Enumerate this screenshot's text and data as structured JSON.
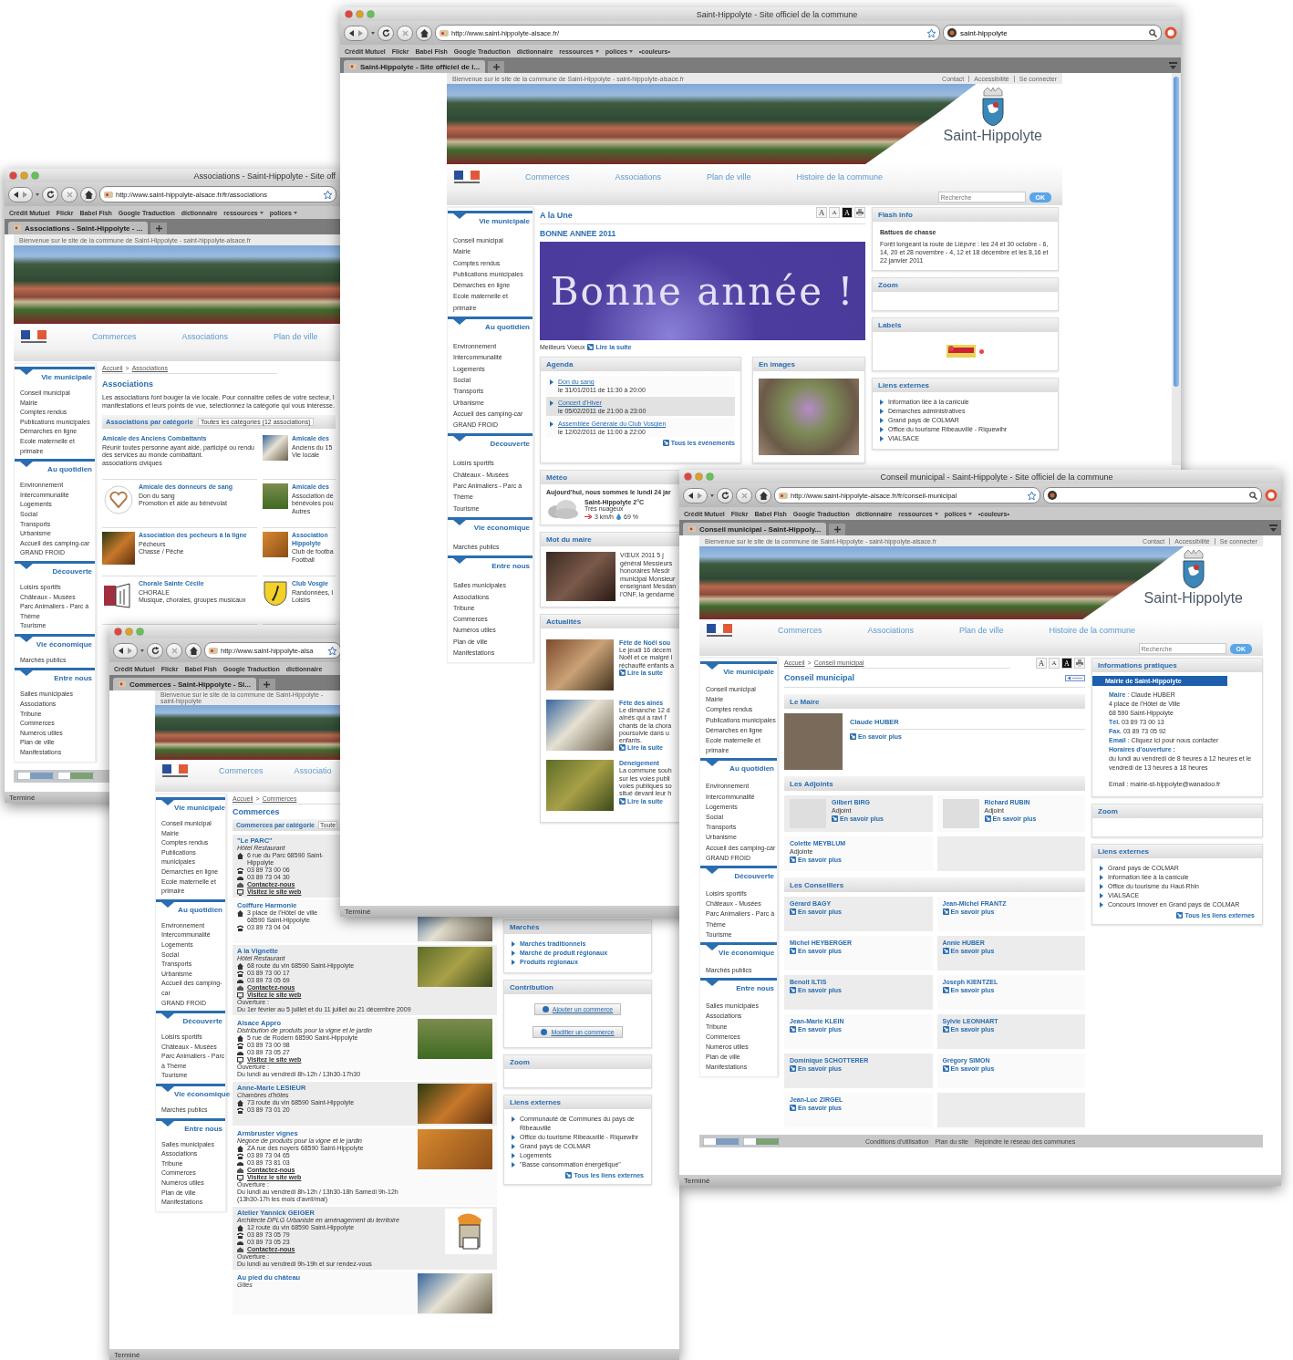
{
  "windows": [
    {
      "kind": "associations",
      "title": "Associations - Saint-Hippolyte - Site off",
      "url": "http://www.saint-hippolyte-alsace.fr/fr/associations",
      "search": false,
      "bookmarks": [
        {
          "label": "Crédit Mutuel",
          "menu": false
        },
        {
          "label": "Flickr",
          "menu": false
        },
        {
          "label": "Babel Fish",
          "menu": false
        },
        {
          "label": "Google Traduction",
          "menu": false
        },
        {
          "label": "dictionnaire",
          "menu": false
        },
        {
          "label": "ressources",
          "menu": true
        },
        {
          "label": "polices",
          "menu": true
        }
      ],
      "tab": "Associations - Saint-Hippolyte - ...",
      "status": "Terminé",
      "page": {
        "welcome": "Bienvenue sur le site de la commune de Saint-Hippolyte - saint-hippolyte-alsace.fr",
        "nav": [
          "Commerces",
          "Associations",
          "Plan de ville"
        ],
        "sidebar": [
          {
            "title": "Vie municipale",
            "items": [
              "Conseil municipal",
              "Mairie",
              "Comptes rendus",
              "Publications municipales",
              "Démarches en ligne",
              "Ecole maternelle et primaire"
            ]
          },
          {
            "title": "Au quotidien",
            "items": [
              "Environnement",
              "Intercommunalité",
              "Logements",
              "Social",
              "Transports",
              "Urbanisme",
              "Accueil des camping-car",
              "GRAND FROID"
            ]
          },
          {
            "title": "Découverte",
            "items": [
              "Loisirs sportifs",
              "Châteaux - Musées",
              "Parc Animaliers - Parc à Thème",
              "Tourisme"
            ]
          },
          {
            "title": "Vie économique",
            "items": [
              "Marchés publics"
            ]
          },
          {
            "title": "Entre nous",
            "items": [
              "Salles municipales",
              "Associations",
              "Tribune",
              "Commerces",
              "Numéros utiles",
              "Plan de ville",
              "Manifestations"
            ]
          }
        ],
        "content": {
          "kind": "associations",
          "breadcrumb": [
            "Accueil",
            "Associations"
          ],
          "separator": ">",
          "heading": "Associations",
          "intro": [
            "Les associations font bouger la vie locale. Pour connaître celles de votre secteur, l",
            "manifestations et leurs points de vue, sélectionnez la catégorie qui vous intéresse."
          ],
          "category": {
            "label": "Associations par catégorie",
            "select": "Toutes les catégories (12 associations)"
          },
          "entries": [
            {
              "name": "Amicale des Anciens Combattants",
              "lines": [
                "Réunir toutes personne ayant aidé, participé ou rendu des services au monde combattant.",
                "associations civiques"
              ],
              "kind": "text"
            },
            {
              "name": "Amicale des",
              "lines": [
                "Anciens du 15",
                "Vie locale"
              ],
              "kind": "photo"
            },
            {
              "name": "Amicale des donneurs de sang",
              "lines": [
                "Don du sang",
                "Promotion et aide au bénévolat"
              ],
              "kind": "logo"
            },
            {
              "name": "Amicale des",
              "lines": [
                "Association de",
                "bénévoles pou",
                "Autres"
              ],
              "kind": "photo"
            },
            {
              "name": "Association des pecheurs à la ligne",
              "lines": [
                "Pêcheurs",
                "Chasse / Pêche"
              ],
              "kind": "photo"
            },
            {
              "name": "Association Hippolyte",
              "lines": [
                "Club de footba",
                "Football"
              ],
              "kind": "photo"
            },
            {
              "name": "Chorale Sainte Cécile",
              "lines": [
                "CHORALE",
                "Musique, chorales, groupes musicaux"
              ],
              "kind": "drawing"
            },
            {
              "name": "Club Vosgie",
              "lines": [
                "Randonnées, l",
                "Loisirs"
              ],
              "kind": "shield"
            }
          ]
        },
        "footer": true
      }
    },
    {
      "kind": "commerces",
      "url": "http://www.saint-hippolyte-alsa",
      "search": false,
      "bookmarks": [
        {
          "label": "Crédit Mutuel",
          "menu": false
        },
        {
          "label": "Flickr",
          "menu": false
        },
        {
          "label": "Babel Fish",
          "menu": false
        },
        {
          "label": "Google Traduction",
          "menu": false
        },
        {
          "label": "dictionnaire",
          "menu": false
        }
      ],
      "tab": "Commerces - Saint-Hippolyte - Si...",
      "status": "Terminé",
      "page": {
        "welcome": "Bienvenue sur le site de la commune de Saint-Hippolyte - saint-hippolyte",
        "nav": [
          "Commerces",
          "Associatio"
        ],
        "sidebar": [
          {
            "title": "Vie municipale",
            "items": [
              "Conseil municipal",
              "Mairie",
              "Comptes rendus",
              "Publications municipales",
              "Démarches en ligne",
              "Ecole maternelle et primaire"
            ]
          },
          {
            "title": "Au quotidien",
            "items": [
              "Environnement",
              "Intercommunalité",
              "Logements",
              "Social",
              "Transports",
              "Urbanisme",
              "Accueil des camping-car",
              "GRAND FROID"
            ]
          },
          {
            "title": "Découverte",
            "items": [
              "Loisirs sportifs",
              "Châteaux - Musées",
              "Parc Animaliers - Parc à Thème",
              "Tourisme"
            ]
          },
          {
            "title": "Vie économique",
            "items": [
              "Marchés publics"
            ]
          },
          {
            "title": "Entre nous",
            "items": [
              "Salles municipales",
              "Associations",
              "Tribune",
              "Commerces",
              "Numéros utiles",
              "Plan de ville",
              "Manifestations"
            ]
          }
        ],
        "content": {
          "kind": "commerces",
          "breadcrumb": [
            "Accueil",
            "Commerces"
          ],
          "separator": ">",
          "heading": "Commerces",
          "category": {
            "label": "Commerces par catégorie",
            "select": "Toute"
          },
          "entries": [
            {
              "name": "\"Le PARC\"",
              "subtitle": "Hôtel Restaurant",
              "kind": "text",
              "fields": [
                {
                  "kind": "address",
                  "text": "6 rue du Parc 68590 Saint-Hippolyte"
                },
                {
                  "kind": "phone",
                  "text": "03 89 73 00 06"
                },
                {
                  "kind": "fax",
                  "text": "03 89 73 04 30"
                },
                {
                  "kind": "contact",
                  "text": "Contactez-nous"
                },
                {
                  "kind": "web",
                  "text": "Visitez le site web"
                }
              ]
            },
            {
              "name": "Coiffure Harmonie",
              "kind": "photo",
              "fields": [
                {
                  "kind": "address",
                  "text": "3 place de l'Hôtel de ville 68590 Saint-Hippolyte"
                },
                {
                  "kind": "phone",
                  "text": "03 89 73 04 04"
                }
              ]
            },
            {
              "name": "A la Vignette",
              "subtitle": "Hôtel Restaurant",
              "kind": "photo",
              "fields": [
                {
                  "kind": "address",
                  "text": "68 route du vin 68590 Saint-Hippolyte"
                },
                {
                  "kind": "phone",
                  "text": "03 89 73 00 17"
                },
                {
                  "kind": "fax",
                  "text": "03 89 73 05 69"
                },
                {
                  "kind": "contact",
                  "text": "Contactez-nous"
                },
                {
                  "kind": "web",
                  "text": "Visitez le site web"
                },
                {
                  "kind": "hours_label",
                  "text": "Ouverture :"
                },
                {
                  "kind": "hours",
                  "text": "Du 1er février au 5 juillet et du 11 juillet au 21 décembre 2009"
                }
              ]
            },
            {
              "name": "Alsace Appro",
              "subtitle": "Distribution de produits pour la vigne et le jardin",
              "kind": "photo",
              "fields": [
                {
                  "kind": "address",
                  "text": "5 rue de Rodern 68590 Saint-Hippolyte"
                },
                {
                  "kind": "phone",
                  "text": "03 89 73 00 98"
                },
                {
                  "kind": "fax",
                  "text": "03 89 73 05 27"
                },
                {
                  "kind": "web",
                  "text": "Visitez le site web"
                },
                {
                  "kind": "hours_label",
                  "text": "Ouverture :"
                },
                {
                  "kind": "hours",
                  "text": "Du lundi au vendredi 8h-12h / 13h30-17h30"
                }
              ]
            },
            {
              "name": "Anne-Marie LESIEUR",
              "subtitle": "Chambres d'hôtes",
              "kind": "photo",
              "fields": [
                {
                  "kind": "address",
                  "text": "73 route du vin 68590 Saint-Hippolyte"
                },
                {
                  "kind": "phone",
                  "text": "03 89 73 01 20"
                }
              ]
            },
            {
              "name": "Armbruster vignes",
              "subtitle": "Négoce de produits pour la vigne et le jardin",
              "kind": "photo",
              "fields": [
                {
                  "kind": "address",
                  "text": "ZA rue des noyers 68590 Saint-Hippolyte"
                },
                {
                  "kind": "phone",
                  "text": "03 89 73 04 65"
                },
                {
                  "kind": "fax",
                  "text": "03 89 73 81 03"
                },
                {
                  "kind": "contact",
                  "text": "Contactez-nous"
                },
                {
                  "kind": "web",
                  "text": "Visitez le site web"
                },
                {
                  "kind": "hours_label",
                  "text": "Ouverture :"
                },
                {
                  "kind": "hours",
                  "text": "Du lundi au vendredi 8h-12h / 13h30-18h Samedi 9h-12h (13h30-17h les mois d'avril/mai)"
                }
              ]
            },
            {
              "name": "Atelier Yannick GEIGER",
              "subtitle": "Architecte DPLG Urbaniste en aménagement du territoire",
              "kind": "drawing",
              "fields": [
                {
                  "kind": "address",
                  "text": "12 route du vin 68590 Saint-Hippolyte"
                },
                {
                  "kind": "phone",
                  "text": "03 89 73 05 79"
                },
                {
                  "kind": "fax",
                  "text": "03 89 73 05 23"
                },
                {
                  "kind": "contact",
                  "text": "Contactez-nous"
                },
                {
                  "kind": "hours_label",
                  "text": "Ouverture :"
                },
                {
                  "kind": "hours",
                  "text": "Du lundi au vendredi 9h-19h et sur rendez-vous"
                }
              ]
            },
            {
              "name": "Au pied du château",
              "subtitle": "Gîtes",
              "kind": "photo"
            }
          ]
        },
        "side": [
          {
            "kind": "nav_links",
            "title": "Marchés",
            "items": [
              "Marchés traditionnels",
              "Marché de produit régionaux",
              "Produits régionaux"
            ]
          },
          {
            "kind": "buttons",
            "title": "Contribution",
            "buttons": [
              "Ajouter un commerce",
              "Modifier un commerce"
            ]
          },
          {
            "kind": "empty",
            "title": "Zoom"
          },
          {
            "kind": "links",
            "title": "Liens externes",
            "items": [
              "Communauté de Communes du pays de Ribeauvillé",
              "Office du tourisme Ribeauvillé - Riquewihr",
              "Grand pays de COLMAR",
              "Logements",
              "\"Basse consommation énergétique\""
            ],
            "more": "Tous les liens externes"
          }
        ]
      }
    },
    {
      "kind": "main",
      "title": "Saint-Hippolyte - Site officiel de la commune",
      "url": "http://www.saint-hippolyte-alsace.fr/",
      "search": true,
      "search_value": "saint-hippolyte",
      "bookmarks": [
        {
          "label": "Crédit Mutuel",
          "menu": false
        },
        {
          "label": "Flickr",
          "menu": false
        },
        {
          "label": "Babel Fish",
          "menu": false
        },
        {
          "label": "Google Traduction",
          "menu": false
        },
        {
          "label": "dictionnaire",
          "menu": false
        },
        {
          "label": "ressources",
          "menu": true
        },
        {
          "label": "polices",
          "menu": true
        },
        {
          "label": "•couleurs•",
          "menu": false
        }
      ],
      "tab": "Saint-Hippolyte - Site officiel de l...",
      "status": "Terminé",
      "page": {
        "welcome": "Bienvenue sur le site de la commune de Saint-Hippolyte - saint-hippolyte-alsace.fr",
        "top_links": [
          "Contact",
          "Accessibilité",
          "Se connecter"
        ],
        "site_name": "Saint-Hippolyte",
        "nav": [
          "Commerces",
          "Associations",
          "Plan de ville",
          "Histoire de la commune"
        ],
        "search": {
          "placeholder": "Recherche",
          "button": "OK"
        },
        "sidebar": [
          {
            "title": "Vie municipale",
            "items": [
              "Conseil municipal",
              "Mairie",
              "Comptes rendus",
              "Publications municipales",
              "Démarches en ligne",
              "Ecole maternelle et primaire"
            ]
          },
          {
            "title": "Au quotidien",
            "items": [
              "Environnement",
              "Intercommunalité",
              "Logements",
              "Social",
              "Transports",
              "Urbanisme",
              "Accueil des camping-car",
              "GRAND FROID"
            ]
          },
          {
            "title": "Découverte",
            "items": [
              "Loisirs sportifs",
              "Châteaux - Musées",
              "Parc Animaliers - Parc à Thème",
              "Tourisme"
            ]
          },
          {
            "title": "Vie économique",
            "items": [
              "Marchés publics"
            ]
          },
          {
            "title": "Entre nous",
            "items": [
              "Salles municipales",
              "Associations",
              "Tribune",
              "Commerces",
              "Numéros utiles",
              "Plan de ville",
              "Manifestations"
            ]
          }
        ],
        "content": {
          "kind": "une",
          "heading": "A la Une",
          "tools": [
            {
              "kind": "larger",
              "label": "A"
            },
            {
              "kind": "smaller",
              "label": "A"
            },
            {
              "kind": "contrast",
              "label": "A"
            },
            {
              "kind": "print"
            }
          ],
          "news_title": "BONNE ANNEE 2011",
          "greeting": "Bonne année !",
          "caption": "Meilleurs Voeux",
          "read_more": "Lire la suite",
          "agenda": {
            "title": "Agenda",
            "items": [
              {
                "title": "Don du sang",
                "date": "le 31/01/2011 de 11:30 à 20:00",
                "highlighted": false
              },
              {
                "title": "Concert d'Hiver",
                "date": "le 05/02/2011 de 21:00 à 23:00",
                "highlighted": true
              },
              {
                "title": "Assemblée Générale du Club Vosgien",
                "date": "le 12/02/2011 de 11:00 à 22:00",
                "highlighted": false
              }
            ],
            "more": "Tous les événements"
          },
          "images_title": "En images",
          "weather": {
            "title": "Météo",
            "today": "Aujourd'hui, nous sommes le lundi 24 jar",
            "place": "Saint-Hippolyte 2°C",
            "condition": "Très nuageux",
            "wind": "3 km/h",
            "humidity": "69 %"
          },
          "mayor": {
            "title": "Mot du maire",
            "text": "VŒUX 2011 5 j général Messieurs honoraires Mesdr municipal Monsieur enseignant Mesdan l'ONF, la gendarme"
          },
          "news": {
            "title": "Actualités",
            "items": [
              {
                "title": "Fête de Noël sou",
                "text": "Le jeudi 16 décem Noël et ce malgré l réchauffé enfants a",
                "link": "Lire la suite"
              },
              {
                "title": "Fête des aînés",
                "text": "Le dimanche 12 d aînés qui a ravi l' chants de la chora poursuivie dans u enfants.",
                "link": "Lire la suite"
              },
              {
                "title": "Déneigement",
                "text": "La commune souh sur les voies publi voies publiques so situé devant leur h",
                "link": "Lire la suite"
              }
            ]
          }
        },
        "side": [
          {
            "kind": "text",
            "title": "Flash info",
            "subtitle": "Battues de chasse",
            "text": "Forêt longeant la route de Lièpvre : les 24 et 30 octobre - 6, 14, 20 et 28 novembre - 4, 12 et 18 décembre et les 8,16 et 22 janvier 2011"
          },
          {
            "kind": "empty",
            "title": "Zoom"
          },
          {
            "kind": "labels",
            "title": "Labels"
          },
          {
            "kind": "links",
            "title": "Liens externes",
            "items": [
              "Information liée à la canicule",
              "Démarches administratives",
              "Grand pays de COLMAR",
              "Office du tourisme Ribeauvillé - Riquewihr",
              "VIALSACE"
            ]
          }
        ]
      }
    },
    {
      "kind": "conseil",
      "title": "Conseil municipal - Saint-Hippolyte - Site officiel de la commune",
      "url": "http://www.saint-hippolyte-alsace.fr/fr/conseil-municipal",
      "search": true,
      "bookmarks": [
        {
          "label": "Crédit Mutuel",
          "menu": false
        },
        {
          "label": "Flickr",
          "menu": false
        },
        {
          "label": "Babel Fish",
          "menu": false
        },
        {
          "label": "Google Traduction",
          "menu": false
        },
        {
          "label": "dictionnaire",
          "menu": false
        },
        {
          "label": "ressources",
          "menu": true
        },
        {
          "label": "polices",
          "menu": true
        },
        {
          "label": "•couleurs•",
          "menu": false
        }
      ],
      "tab": "Conseil municipal - Saint-Hippoly...",
      "status": "Terminé",
      "page": {
        "welcome": "Bienvenue sur le site de la commune de Saint-Hippolyte - saint-hippolyte-alsace.fr",
        "top_links": [
          "Contact",
          "Accessibilité",
          "Se connecter"
        ],
        "site_name": "Saint-Hippolyte",
        "nav": [
          "Commerces",
          "Associations",
          "Plan de ville",
          "Histoire de la commune"
        ],
        "search": {
          "placeholder": "Recherche",
          "button": "OK"
        },
        "sidebar": [
          {
            "title": "Vie municipale",
            "items": [
              "Conseil municipal",
              "Mairie",
              "Comptes rendus",
              "Publications municipales",
              "Démarches en ligne",
              "Ecole maternelle et primaire"
            ]
          },
          {
            "title": "Au quotidien",
            "items": [
              "Environnement",
              "Intercommunalité",
              "Logements",
              "Social",
              "Transports",
              "Urbanisme",
              "Accueil des camping-car",
              "GRAND FROID"
            ]
          },
          {
            "title": "Découverte",
            "items": [
              "Loisirs sportifs",
              "Châteaux - Musées",
              "Parc Animaliers - Parc à Thème",
              "Tourisme"
            ]
          },
          {
            "title": "Vie économique",
            "items": [
              "Marchés publics"
            ]
          },
          {
            "title": "Entre nous",
            "items": [
              "Salles municipales",
              "Associations",
              "Tribune",
              "Commerces",
              "Numéros utiles",
              "Plan de ville",
              "Manifestations"
            ]
          }
        ],
        "content": {
          "kind": "conseil",
          "breadcrumb": [
            "Accueil",
            "Conseil municipal"
          ],
          "separator": ">",
          "heading": "Conseil municipal",
          "tools": [
            {
              "kind": "larger",
              "label": "A"
            },
            {
              "kind": "smaller",
              "label": "A"
            },
            {
              "kind": "contrast",
              "label": "A"
            },
            {
              "kind": "print"
            }
          ],
          "groups": [
            {
              "title": "Le Maire",
              "kind": "feature",
              "members": [
                {
                  "name": "Claude HUBER",
                  "link": "En savoir plus",
                  "photo": true
                }
              ]
            },
            {
              "title": "Les Adjoints",
              "kind": "grid",
              "members": [
                {
                  "name": "Gilbert BIRG",
                  "role": "Adjoint",
                  "link": "En savoir plus",
                  "photo": true
                },
                {
                  "name": "Richard RUBIN",
                  "role": "Adjoint",
                  "link": "En savoir plus",
                  "photo": true
                },
                {
                  "name": "Colette MEYBLUM",
                  "role": "Adjointe",
                  "link": "En savoir plus",
                  "photo": false
                }
              ]
            },
            {
              "title": "Les Conseillers",
              "kind": "grid",
              "members": [
                {
                  "name": "Gérard BAGY",
                  "link": "En savoir plus",
                  "photo": false
                },
                {
                  "name": "Jean-Michel FRANTZ",
                  "link": "En savoir plus",
                  "photo": false
                },
                {
                  "name": "Michel HEYBERGER",
                  "link": "En savoir plus",
                  "photo": false
                },
                {
                  "name": "Annie HUBER",
                  "link": "En savoir plus",
                  "photo": false
                },
                {
                  "name": "Benoit ILTIS",
                  "link": "En savoir plus",
                  "photo": false
                },
                {
                  "name": "Joseph KIENTZEL",
                  "link": "En savoir plus",
                  "photo": false
                },
                {
                  "name": "Jean-Marie KLEIN",
                  "link": "En savoir plus",
                  "photo": false
                },
                {
                  "name": "Sylvie LEONHART",
                  "link": "En savoir plus",
                  "photo": false
                },
                {
                  "name": "Dominique SCHOTTERER",
                  "link": "En savoir plus",
                  "photo": false
                },
                {
                  "name": "Grégory SIMON",
                  "link": "En savoir plus",
                  "photo": false
                },
                {
                  "name": "Jean-Luc ZIRGEL",
                  "link": "En savoir plus",
                  "photo": false
                }
              ]
            }
          ]
        },
        "side": [
          {
            "kind": "contact",
            "title": "Informations pratiques",
            "tab": "Mairie de Saint-Hippolyte",
            "lines": [
              "**Maire** : Claude HUBER",
              "4 place de l'Hôtel de Ville",
              "68 590 Saint-Hippolyte",
              "**Tél.** 03 89 73 00 13",
              "**Fax.** 03 89 73 05 92",
              "**Email** : Cliquez ici pour nous contacter",
              "**Horaires d'ouverture :**",
              "du lundi au vendredi de 8 heures à 12 heures et le vendredi de 13 heures à 18 heures",
              "Email : mairie-st-hippolyte@wanadoo.fr"
            ]
          },
          {
            "kind": "empty",
            "title": "Zoom"
          },
          {
            "kind": "links",
            "title": "Liens externes",
            "items": [
              "Grand pays de COLMAR",
              "Information liée à la canicule",
              "Office du tourisme du Haut-Rhin",
              "VIALSACE",
              "Concours innover en Grand pays de COLMAR"
            ],
            "more": "Tous les liens externes"
          }
        ],
        "footer": true,
        "footer_links": [
          "Conditions d'utilisation",
          "Plan du site",
          "Rejoindre le réseau des communes"
        ]
      }
    }
  ]
}
